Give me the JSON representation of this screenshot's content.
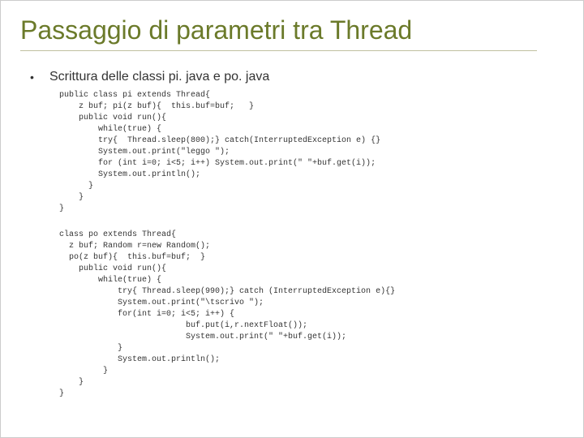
{
  "title": "Passaggio di parametri tra Thread",
  "bullet": "•",
  "subtitle": "Scrittura delle classi pi. java e po. java",
  "code1": "public class pi extends Thread{\n    z buf; pi(z buf){  this.buf=buf;   }\n    public void run(){\n        while(true) {\n        try{  Thread.sleep(800);} catch(InterruptedException e) {}\n        System.out.print(\"leggo \");\n        for (int i=0; i<5; i++) System.out.print(\" \"+buf.get(i));\n        System.out.println();\n      }\n    }\n}",
  "code2": "class po extends Thread{\n  z buf; Random r=new Random();\n  po(z buf){  this.buf=buf;  }\n    public void run(){\n        while(true) {\n            try{ Thread.sleep(990);} catch (InterruptedException e){}\n            System.out.print(\"\\tscrivo \");\n            for(int i=0; i<5; i++) {\n                          buf.put(i,r.nextFloat());\n                          System.out.print(\" \"+buf.get(i));\n            }\n            System.out.println();\n         }\n    }\n}"
}
